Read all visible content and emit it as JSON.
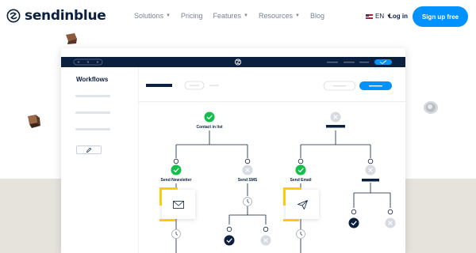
{
  "nav": {
    "brand": "sendinblue",
    "links": [
      {
        "label": "Solutions",
        "has_caret": true
      },
      {
        "label": "Pricing",
        "has_caret": false
      },
      {
        "label": "Features",
        "has_caret": true
      },
      {
        "label": "Resources",
        "has_caret": true
      },
      {
        "label": "Blog",
        "has_caret": false
      }
    ],
    "language": "EN",
    "login_label": "Log in",
    "signup_label": "Sign up free"
  },
  "app": {
    "sidebar_title": "Workflows",
    "workflow": {
      "root_left_label": "Contact in list",
      "left_branch_a_label": "Send Newsletter",
      "left_branch_b_label": "Send SMS",
      "right_branch_a_label": "Send Email"
    }
  },
  "colors": {
    "brand_navy": "#0b1f3f",
    "accent_blue": "#0092ff",
    "success_green": "#12bf4a",
    "highlight_yellow": "#ffcb05",
    "muted_grey": "#d7dbe1"
  },
  "icons": {
    "logo": "sendinblue-logo-icon",
    "edit": "pencil-icon",
    "email": "envelope-icon",
    "send": "paper-plane-icon",
    "wait": "clock-icon",
    "check": "check-icon",
    "cross": "close-icon"
  }
}
